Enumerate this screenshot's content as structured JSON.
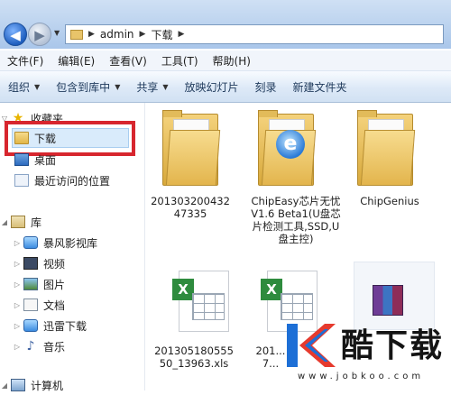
{
  "address": {
    "segments": [
      "admin",
      "下载"
    ]
  },
  "menu": {
    "items": [
      "文件(F)",
      "编辑(E)",
      "查看(V)",
      "工具(T)",
      "帮助(H)"
    ]
  },
  "toolbar": {
    "organize": "组织",
    "include_in_library": "包含到库中",
    "share": "共享",
    "slideshow": "放映幻灯片",
    "burn": "刻录",
    "new_folder": "新建文件夹"
  },
  "sidebar": {
    "favorites": "收藏夹",
    "downloads": "下载",
    "desktop": "桌面",
    "recent": "最近访问的位置",
    "libraries": "库",
    "lib_items": [
      "暴风影视库",
      "视频",
      "图片",
      "文档",
      "迅雷下载",
      "音乐"
    ],
    "computer": "计算机"
  },
  "files": [
    {
      "name": "20130320043247335",
      "type": "folder"
    },
    {
      "name": "ChipEasy芯片无忧 V1.6 Beta1(U盘芯片检测工具,SSD,U盘主控)",
      "type": "folder"
    },
    {
      "name": "ChipGenius",
      "type": "folder"
    },
    {
      "name": "20130518055550_13963.xls",
      "type": "xls"
    },
    {
      "name": "201...7...",
      "type": "xls"
    },
    {
      "name": "",
      "type": "rar"
    }
  ],
  "watermark": {
    "brand": "酷下载",
    "url": "www.jobkoo.com"
  },
  "colors": {
    "highlight_border": "#d7262e",
    "selection": "#d9ebfb"
  }
}
